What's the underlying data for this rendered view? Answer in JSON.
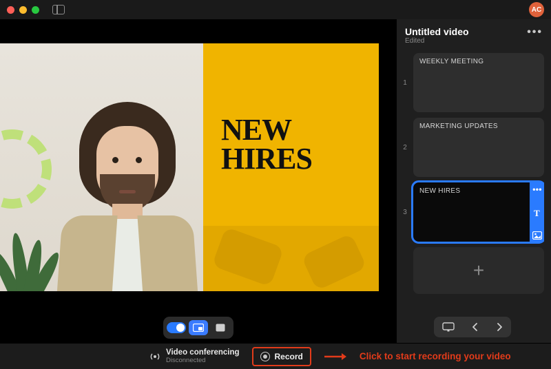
{
  "avatar_initials": "AC",
  "slide_overlay": {
    "line1": "NEW",
    "line2": "HIRES"
  },
  "sidebar": {
    "title": "Untitled video",
    "subtitle": "Edited",
    "slides": [
      {
        "num": "1",
        "label": "WEEKLY MEETING"
      },
      {
        "num": "2",
        "label": "MARKETING UPDATES"
      },
      {
        "num": "3",
        "label": "NEW HIRES"
      }
    ]
  },
  "status": {
    "vc_title": "Video conferencing",
    "vc_status": "Disconnected",
    "record_label": "Record",
    "record_hint": "Click to start recording your video"
  }
}
